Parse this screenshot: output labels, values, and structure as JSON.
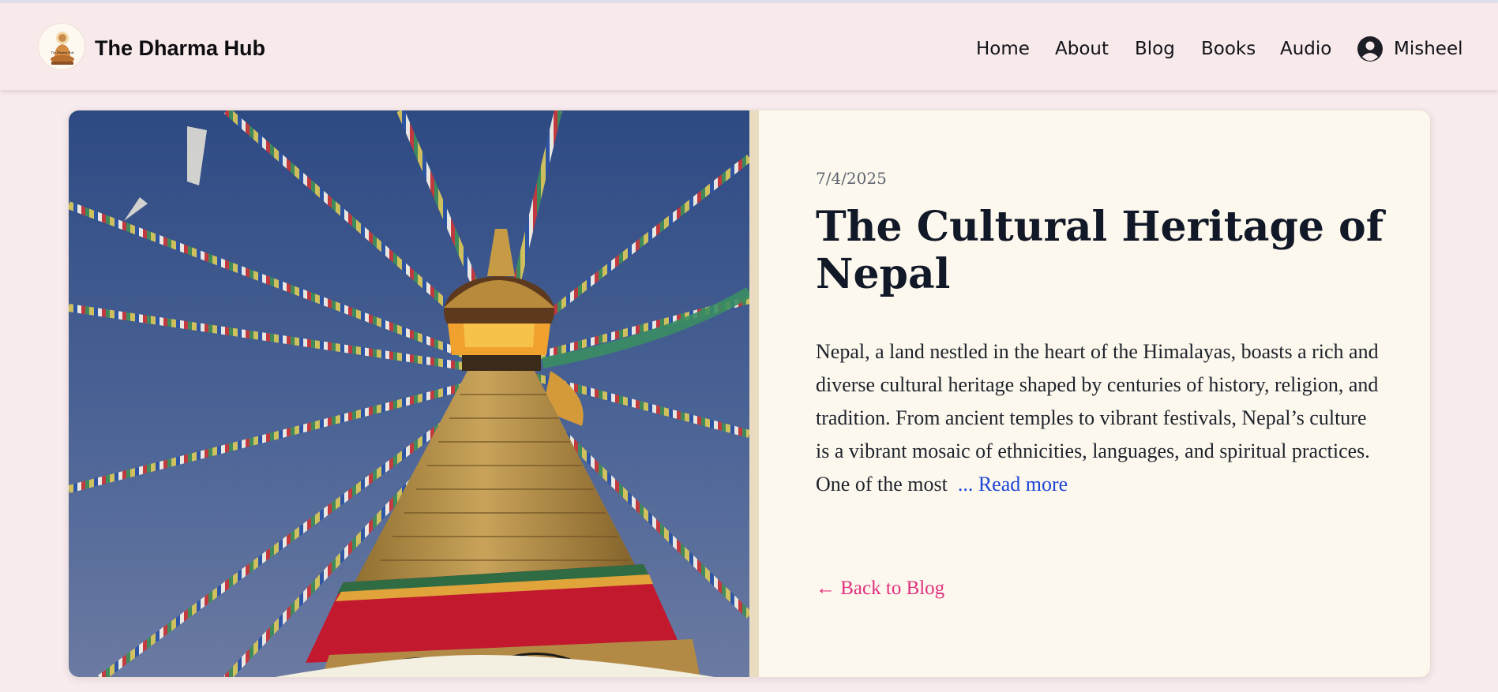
{
  "nav": {
    "logo_text": "The Dharma Hub",
    "brand": "The Dharma Hub",
    "links": [
      "Home",
      "About",
      "Blog",
      "Books",
      "Audio"
    ],
    "user_name": "Misheel"
  },
  "post": {
    "date": "7/4/2025",
    "title": "The Cultural Heritage of Nepal",
    "excerpt": "Nepal, a land nestled in the heart of the Himalayas, boasts a rich and diverse cultural heritage shaped by centuries of history, religion, and tradition. From ancient temples to vibrant festivals, Nepal’s culture is a vibrant mosaic of ethnicities, languages, and spiritual practices. One of the most",
    "read_more": "... Read more",
    "back_link": "← Back to Blog"
  },
  "colors": {
    "page_bg": "#f8ecee",
    "card_bg": "#fdf8ee",
    "read_more": "#1d46d6",
    "back_link": "#e0307e"
  },
  "icons": {
    "logo": "buddha-logo-icon",
    "user": "user-circle-icon"
  }
}
